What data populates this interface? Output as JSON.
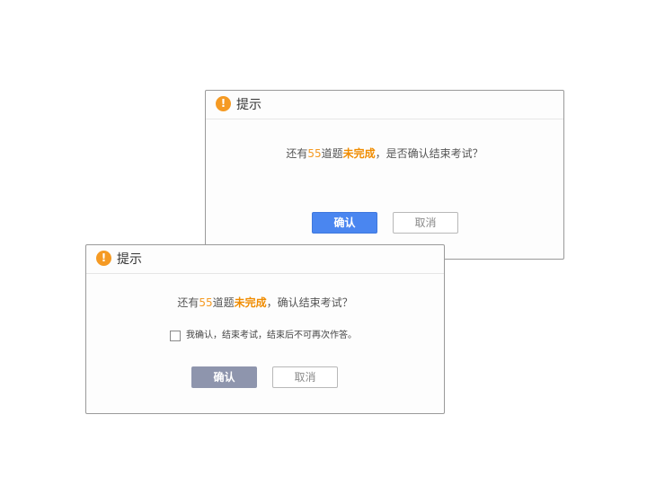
{
  "dialog_end_exam": {
    "title": "提示",
    "icon": "warning-icon",
    "message": {
      "prefix": "还有",
      "count": "55",
      "middle": "道题",
      "status": "未完成",
      "suffix": "，是否确认结束考试？"
    },
    "confirm_label": "确认",
    "cancel_label": "取消"
  },
  "dialog_end_exam_checkbox": {
    "title": "提示",
    "icon": "warning-icon",
    "message": {
      "prefix": "还有",
      "count": "55",
      "middle": "道题",
      "status": "未完成",
      "suffix": "，确认结束考试？"
    },
    "checkbox_label": "我确认，结束考试，结束后不可再次作答。",
    "checkbox_checked": false,
    "confirm_label": "确认",
    "confirm_state": "disabled",
    "cancel_label": "取消"
  },
  "colors": {
    "warning": "#f59a23",
    "highlight": "#f08c00",
    "primary": "#4a86f0",
    "disabled": "#8e95ad"
  },
  "warning_glyph": "!"
}
